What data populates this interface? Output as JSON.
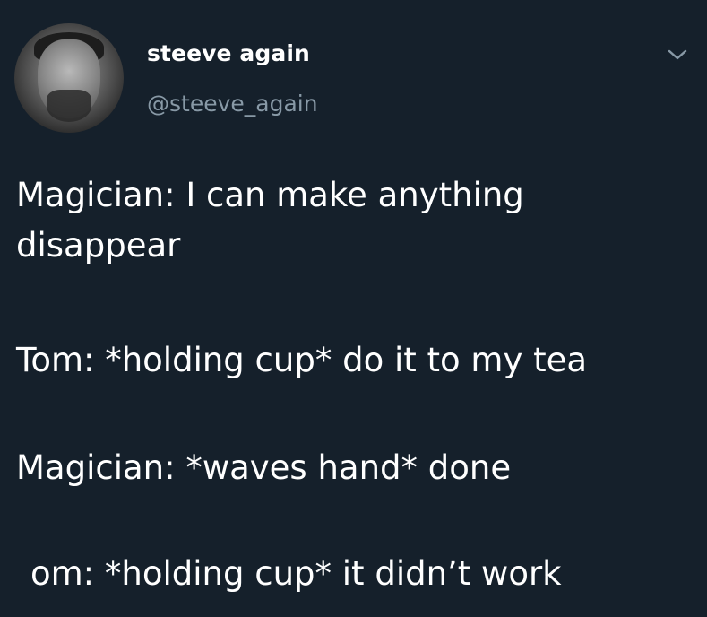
{
  "tweet": {
    "author": {
      "display_name": "steeve again",
      "handle": "@steeve_again",
      "avatar_icon": "person-avatar-icon"
    },
    "caret_icon": "chevron-down-icon",
    "lines": [
      "Magician: I can make anything disappear",
      "Tom: *holding cup* do it to my tea",
      "Magician: *waves hand* done",
      "om: *holding cup* it didn’t work"
    ]
  },
  "colors": {
    "background": "#15202b",
    "primary_text": "#ffffff",
    "secondary_text": "#8899a6"
  }
}
